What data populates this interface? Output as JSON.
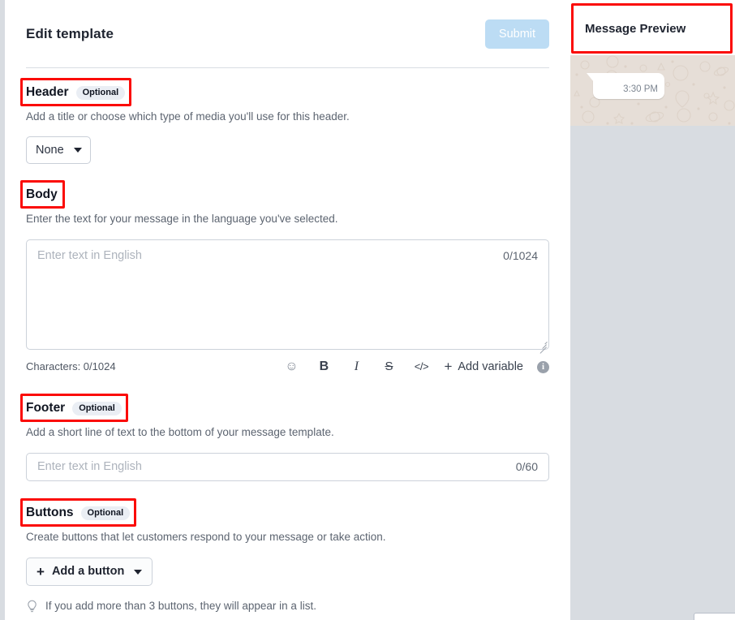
{
  "editor": {
    "title": "Edit template",
    "submit_label": "Submit",
    "sections": {
      "header": {
        "title": "Header",
        "badge": "Optional",
        "description": "Add a title or choose which type of media you'll use for this header.",
        "select_value": "None",
        "select_caret_icon": "chevron-down-icon"
      },
      "body": {
        "title": "Body",
        "badge": "",
        "description": "Enter the text for your message in the language you've selected.",
        "textarea_placeholder": "Enter text in English",
        "textarea_counter": "0/1024",
        "char_count_label": "Characters: 0/1024",
        "toolbar": {
          "emoji": "☺",
          "bold": "B",
          "italic": "I",
          "strikethrough": "S",
          "code": "</>",
          "add_variable_plus": "+",
          "add_variable_label": "Add variable",
          "info": "i"
        }
      },
      "footer": {
        "title": "Footer",
        "badge": "Optional",
        "description": "Add a short line of text to the bottom of your message template.",
        "input_placeholder": "Enter text in English",
        "input_counter": "0/60"
      },
      "buttons": {
        "title": "Buttons",
        "badge": "Optional",
        "description": "Create buttons that let customers respond to your message or take action.",
        "add_button_plus": "+",
        "add_button_label": "Add a button",
        "hint": "If you add more than 3 buttons, they will appear in a list."
      }
    }
  },
  "preview": {
    "title": "Message Preview",
    "bubble_time": "3:30 PM"
  },
  "colors": {
    "submit_disabled": "#bcdcf4",
    "annotation_red": "#fb0b07",
    "page_background": "#d8dce1",
    "chat_background": "#e6ded7",
    "badge_background": "#eaeef4"
  }
}
